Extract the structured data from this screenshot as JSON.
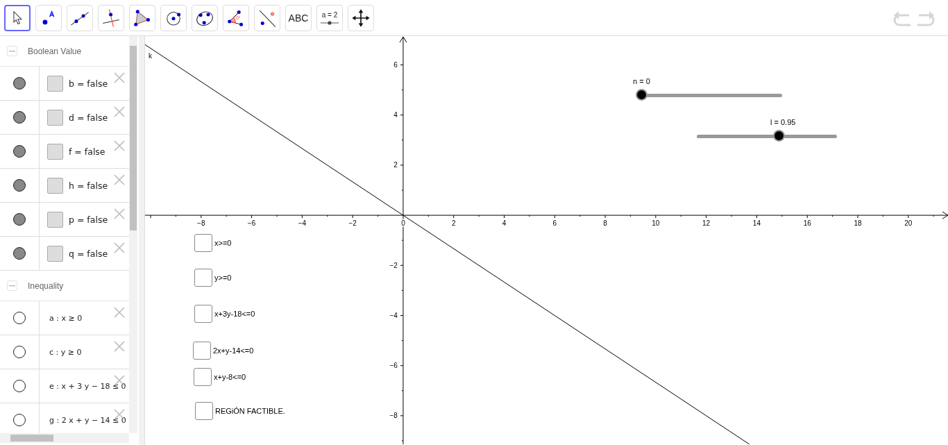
{
  "toolbar": {
    "tools": [
      {
        "kind": "move",
        "selected": true
      },
      {
        "kind": "point",
        "selected": false
      },
      {
        "kind": "line",
        "selected": false
      },
      {
        "kind": "perpendicular",
        "selected": false
      },
      {
        "kind": "polygon",
        "selected": false
      },
      {
        "kind": "circle",
        "selected": false
      },
      {
        "kind": "conic",
        "selected": false
      },
      {
        "kind": "angle",
        "selected": false
      },
      {
        "kind": "reflect",
        "selected": false
      },
      {
        "kind": "text",
        "selected": false,
        "label": "ABC"
      },
      {
        "kind": "slider",
        "selected": false,
        "label": "a = 2"
      },
      {
        "kind": "pan",
        "selected": false
      }
    ],
    "history": [
      {
        "kind": "undo",
        "disabled": true
      },
      {
        "kind": "redo",
        "disabled": true
      }
    ]
  },
  "algebra": {
    "groups": [
      {
        "title": "Boolean Value",
        "expanded": true,
        "items": [
          {
            "kind": "boolean",
            "visible": true,
            "checked": false,
            "text": "b = false"
          },
          {
            "kind": "boolean",
            "visible": true,
            "checked": false,
            "text": "d = false"
          },
          {
            "kind": "boolean",
            "visible": true,
            "checked": false,
            "text": "f = false"
          },
          {
            "kind": "boolean",
            "visible": true,
            "checked": false,
            "text": "h = false"
          },
          {
            "kind": "boolean",
            "visible": true,
            "checked": false,
            "text": "p = false"
          },
          {
            "kind": "boolean",
            "visible": true,
            "checked": false,
            "text": "q = false"
          }
        ]
      },
      {
        "title": "Inequality",
        "expanded": true,
        "items": [
          {
            "kind": "formula",
            "visible": false,
            "text": "a : x ≥ 0"
          },
          {
            "kind": "formula",
            "visible": false,
            "text": "c : y ≥ 0"
          },
          {
            "kind": "formula",
            "visible": false,
            "text": "e : x + 3 y − 18 ≤ 0"
          },
          {
            "kind": "formula",
            "visible": false,
            "text": "g : 2 x + y − 14 ≤ 0"
          }
        ]
      }
    ]
  },
  "graphics": {
    "chart_data": {
      "type": "line",
      "xlim": [
        -10.22,
        21.6
      ],
      "ylim": [
        -9.14,
        7.15
      ],
      "xticks": [
        {
          "value": -8,
          "label": "−8"
        },
        {
          "value": -6,
          "label": "−6"
        },
        {
          "value": -4,
          "label": "−4"
        },
        {
          "value": -2,
          "label": "−2"
        },
        {
          "value": 0,
          "label": "0"
        },
        {
          "value": 2,
          "label": "2"
        },
        {
          "value": 4,
          "label": "4"
        },
        {
          "value": 6,
          "label": "6"
        },
        {
          "value": 8,
          "label": "8"
        },
        {
          "value": 10,
          "label": "10"
        },
        {
          "value": 12,
          "label": "12"
        },
        {
          "value": 14,
          "label": "14"
        },
        {
          "value": 16,
          "label": "16"
        },
        {
          "value": 18,
          "label": "18"
        },
        {
          "value": 20,
          "label": "20"
        }
      ],
      "yticks": [
        {
          "value": -8,
          "label": "−8"
        },
        {
          "value": -6,
          "label": "−6"
        },
        {
          "value": -4,
          "label": "−4"
        },
        {
          "value": -2,
          "label": "−2"
        },
        {
          "value": 2,
          "label": "2"
        },
        {
          "value": 4,
          "label": "4"
        },
        {
          "value": 6,
          "label": "6"
        }
      ],
      "x": [
        -10.22,
        13.71
      ],
      "series": [
        {
          "name": "k",
          "color": "#000000",
          "values": [
            6.81,
            -9.14
          ]
        }
      ]
    },
    "sliders": [
      {
        "label": "n = 0",
        "level": 0
      },
      {
        "label": "l = 0.95",
        "level": 0.59
      }
    ],
    "checkboxes": [
      {
        "label": "x>=0",
        "checked": false
      },
      {
        "label": "y>=0",
        "checked": false
      },
      {
        "label": "x+3y-18<=0",
        "checked": false
      },
      {
        "label": "2x+y-14<=0",
        "checked": false
      },
      {
        "label": "x+y-8<=0",
        "checked": false
      },
      {
        "label": "REGiÓN FACTIBLE.",
        "checked": false
      }
    ]
  }
}
